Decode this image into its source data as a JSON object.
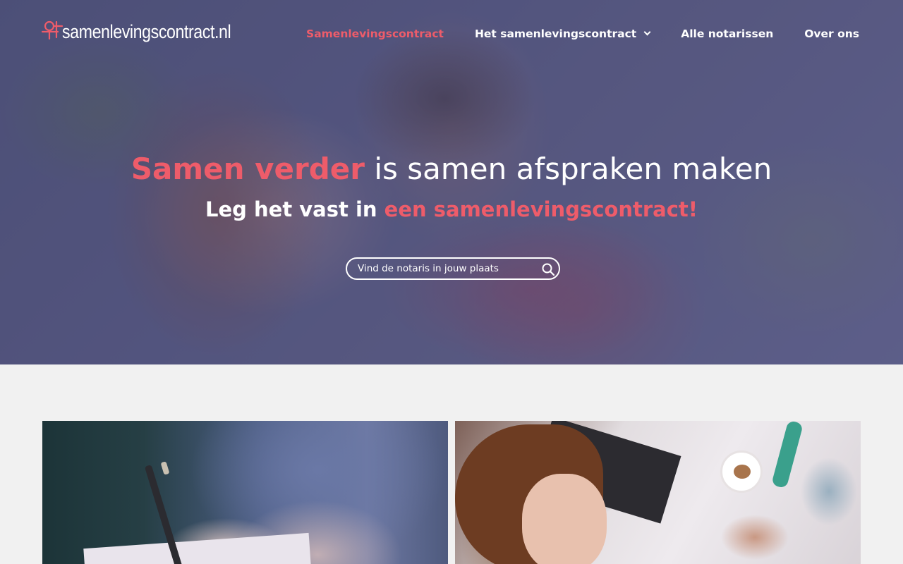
{
  "brand": {
    "logo_text": "samenlevingscontract.nl"
  },
  "nav": {
    "items": [
      {
        "label": "Samenlevingscontract",
        "active": true
      },
      {
        "label": "Het samenlevingscontract",
        "has_dropdown": true
      },
      {
        "label": "Alle notarissen"
      },
      {
        "label": "Over ons"
      }
    ]
  },
  "hero": {
    "headline_highlight": "Samen verder",
    "headline_rest": " is samen afspraken maken",
    "subline_plain": "Leg het vast in ",
    "subline_highlight": "een samenlevingscontract!",
    "search_placeholder": "Vind de notaris in jouw plaats"
  },
  "colors": {
    "accent": "#ee5c6a",
    "hero_overlay": "#50508a",
    "page_background": "#f1f1f1",
    "text_light": "#ffffff"
  },
  "icons": [
    "logo-mark-icon",
    "chevron-down-icon",
    "search-icon"
  ]
}
